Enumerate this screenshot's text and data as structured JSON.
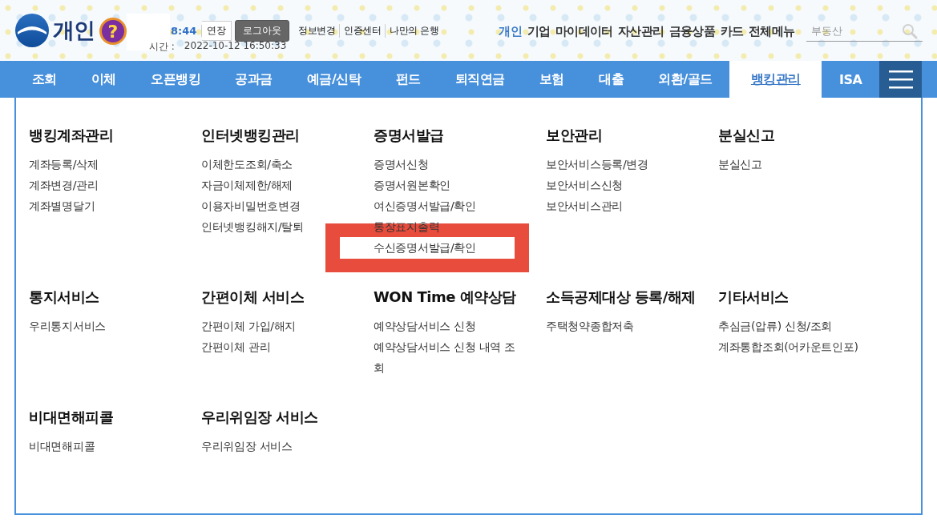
{
  "header": {
    "logo": "개인",
    "help": "?",
    "session": {
      "timer": "8:44",
      "extend": "연장",
      "logout": "로그아웃"
    },
    "links": [
      "정보변경",
      "인증센터",
      "나만의 은행"
    ],
    "last_login": {
      "label": "시간 :",
      "value": "2022-10-12 16:50:33"
    },
    "top_nav": [
      {
        "label": "개인",
        "selected": true
      },
      {
        "label": "기업",
        "selected": false
      },
      {
        "label": "마이데이터",
        "selected": false
      },
      {
        "label": "자산관리",
        "selected": false
      },
      {
        "label": "금융상품",
        "selected": false
      },
      {
        "label": "카드",
        "selected": false
      },
      {
        "label": "전체메뉴",
        "selected": false
      }
    ],
    "search": {
      "placeholder": "부동산"
    }
  },
  "tabs": [
    {
      "label": "조회",
      "selected": false
    },
    {
      "label": "이체",
      "selected": false
    },
    {
      "label": "오픈뱅킹",
      "selected": false
    },
    {
      "label": "공과금",
      "selected": false
    },
    {
      "label": "예금/신탁",
      "selected": false
    },
    {
      "label": "펀드",
      "selected": false
    },
    {
      "label": "퇴직연금",
      "selected": false
    },
    {
      "label": "보험",
      "selected": false
    },
    {
      "label": "대출",
      "selected": false
    },
    {
      "label": "외환/골드",
      "selected": false
    },
    {
      "label": "뱅킹관리",
      "selected": true
    },
    {
      "label": "ISA",
      "selected": false
    }
  ],
  "menu_sections": [
    {
      "title": "뱅킹계좌관리",
      "items": [
        {
          "label": "계좌등록/삭제",
          "highlighted": false
        },
        {
          "label": "계좌변경/관리",
          "highlighted": false
        },
        {
          "label": "계좌별명달기",
          "highlighted": false
        }
      ]
    },
    {
      "title": "인터넷뱅킹관리",
      "items": [
        {
          "label": "이체한도조회/축소",
          "highlighted": false
        },
        {
          "label": "자금이체제한/해제",
          "highlighted": false
        },
        {
          "label": "이용자비밀번호변경",
          "highlighted": false
        },
        {
          "label": "인터넷뱅킹해지/탈퇴",
          "highlighted": false
        }
      ]
    },
    {
      "title": "증명서발급",
      "items": [
        {
          "label": "증명서신청",
          "highlighted": false
        },
        {
          "label": "증명서원본확인",
          "highlighted": false
        },
        {
          "label": "여신증명서발급/확인",
          "highlighted": false
        },
        {
          "label": "통장표지출력",
          "highlighted": false
        },
        {
          "label": "수신증명서발급/확인",
          "highlighted": true
        }
      ]
    },
    {
      "title": "보안관리",
      "items": [
        {
          "label": "보안서비스등록/변경",
          "highlighted": false
        },
        {
          "label": "보안서비스신청",
          "highlighted": false
        },
        {
          "label": "보안서비스관리",
          "highlighted": false
        }
      ]
    },
    {
      "title": "분실신고",
      "items": [
        {
          "label": "분실신고",
          "highlighted": false
        }
      ]
    },
    {
      "title": "통지서비스",
      "items": [
        {
          "label": "우리통지서비스",
          "highlighted": false
        }
      ]
    },
    {
      "title": "간편이체 서비스",
      "items": [
        {
          "label": "간편이체 가입/해지",
          "highlighted": false
        },
        {
          "label": "간편이체 관리",
          "highlighted": false
        }
      ]
    },
    {
      "title": "WON Time 예약상담",
      "items": [
        {
          "label": "예약상담서비스 신청",
          "highlighted": false
        },
        {
          "label": "예약상담서비스 신청 내역 조회",
          "highlighted": false
        }
      ]
    },
    {
      "title": "소득공제대상 등록/해제",
      "items": [
        {
          "label": "주택청약종합저축",
          "highlighted": false
        }
      ]
    },
    {
      "title": "기타서비스",
      "items": [
        {
          "label": "추심금(압류) 신청/조회",
          "highlighted": false
        },
        {
          "label": "계좌통합조회(어카운트인포)",
          "highlighted": false
        }
      ]
    },
    {
      "title": "비대면해피콜",
      "items": [
        {
          "label": "비대면해피콜",
          "highlighted": false
        }
      ]
    },
    {
      "title": "우리위임장 서비스",
      "items": [
        {
          "label": "우리위임장 서비스",
          "highlighted": false
        }
      ]
    }
  ]
}
